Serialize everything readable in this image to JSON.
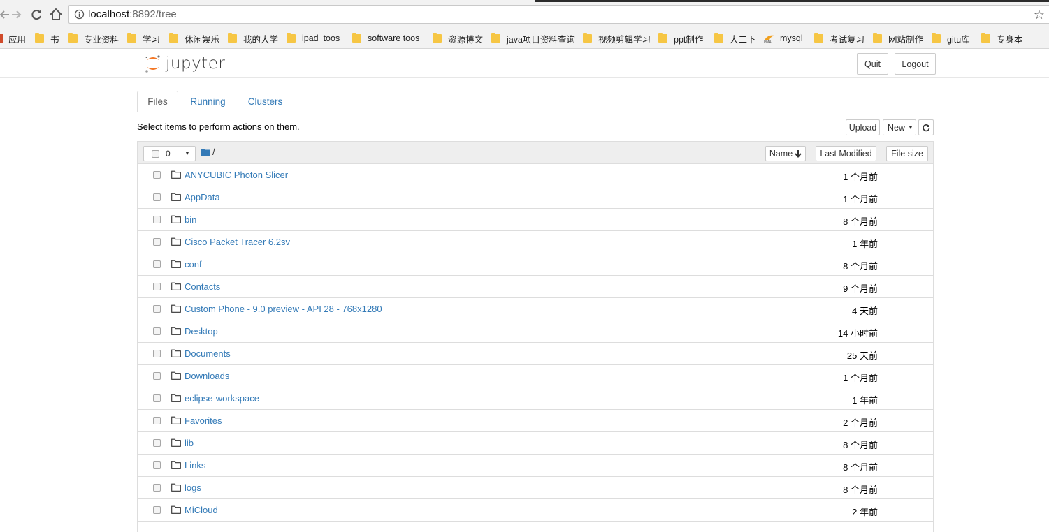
{
  "browser": {
    "url_host": "localhost",
    "url_rest": ":8892/tree",
    "bookmarks": [
      {
        "label": "应用",
        "icon": "apps-icon"
      },
      {
        "label": "书",
        "icon": "folder-icon"
      },
      {
        "label": "专业资料",
        "icon": "folder-icon"
      },
      {
        "label": "学习",
        "icon": "folder-icon"
      },
      {
        "label": "休闲娱乐",
        "icon": "folder-icon"
      },
      {
        "label": "我的大学",
        "icon": "folder-icon"
      },
      {
        "label": "ipad  toos",
        "icon": "folder-icon"
      },
      {
        "label": "software toos",
        "icon": "folder-icon"
      },
      {
        "label": "资源博文",
        "icon": "folder-icon"
      },
      {
        "label": "java项目资料查询",
        "icon": "folder-icon"
      },
      {
        "label": "视频剪辑学习",
        "icon": "folder-icon"
      },
      {
        "label": "ppt制作",
        "icon": "folder-icon"
      },
      {
        "label": "大二下",
        "icon": "folder-icon"
      },
      {
        "label": "mysql",
        "icon": "pma-icon"
      },
      {
        "label": "考试复习",
        "icon": "folder-icon"
      },
      {
        "label": "网站制作",
        "icon": "folder-icon"
      },
      {
        "label": "gitu库",
        "icon": "folder-icon"
      },
      {
        "label": "专身本",
        "icon": "folder-icon"
      }
    ]
  },
  "header": {
    "logo_text": "jupyter",
    "quit_label": "Quit",
    "logout_label": "Logout"
  },
  "tabs": [
    {
      "label": "Files",
      "active": true
    },
    {
      "label": "Running",
      "active": false
    },
    {
      "label": "Clusters",
      "active": false
    }
  ],
  "toolbar": {
    "hint": "Select items to perform actions on them.",
    "upload_label": "Upload",
    "new_label": "New"
  },
  "list_header": {
    "selected_count": "0",
    "breadcrumb": "/",
    "sort_name_label": "Name",
    "last_modified_label": "Last Modified",
    "file_size_label": "File size"
  },
  "files": [
    {
      "name": "ANYCUBIC Photon Slicer",
      "modified": "1 个月前"
    },
    {
      "name": "AppData",
      "modified": "1 个月前"
    },
    {
      "name": "bin",
      "modified": "8 个月前"
    },
    {
      "name": "Cisco Packet Tracer 6.2sv",
      "modified": "1 年前"
    },
    {
      "name": "conf",
      "modified": "8 个月前"
    },
    {
      "name": "Contacts",
      "modified": "9 个月前"
    },
    {
      "name": "Custom Phone - 9.0 preview - API 28 - 768x1280",
      "modified": "4 天前"
    },
    {
      "name": "Desktop",
      "modified": "14 小时前"
    },
    {
      "name": "Documents",
      "modified": "25 天前"
    },
    {
      "name": "Downloads",
      "modified": "1 个月前"
    },
    {
      "name": "eclipse-workspace",
      "modified": "1 年前"
    },
    {
      "name": "Favorites",
      "modified": "2 个月前"
    },
    {
      "name": "lib",
      "modified": "8 个月前"
    },
    {
      "name": "Links",
      "modified": "8 个月前"
    },
    {
      "name": "logs",
      "modified": "8 个月前"
    },
    {
      "name": "MiCloud",
      "modified": "2 年前"
    }
  ],
  "colors": {
    "link": "#337ab7",
    "jupyter_orange": "#f37726",
    "bookmark_folder": "#f6c644"
  }
}
